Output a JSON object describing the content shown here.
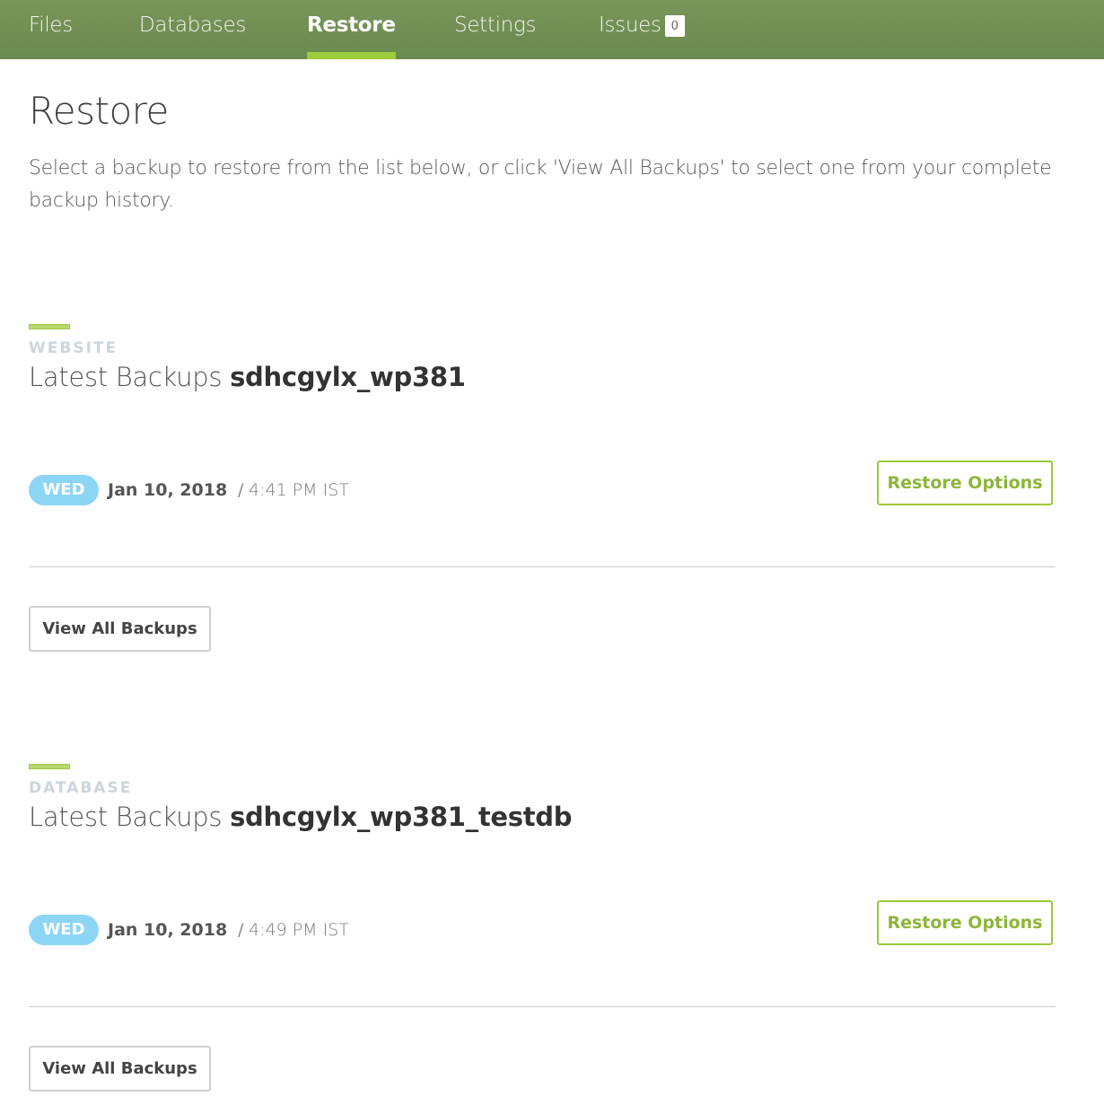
{
  "nav": {
    "tabs": [
      {
        "label": "Files"
      },
      {
        "label": "Databases"
      },
      {
        "label": "Restore",
        "active": true
      },
      {
        "label": "Settings"
      },
      {
        "label": "Issues",
        "count": "0"
      }
    ]
  },
  "page": {
    "title": "Restore",
    "intro": "Select a backup to restore from the list below, or click 'View All Backups' to select one from your complete backup history."
  },
  "sections": [
    {
      "kind": "WEBSITE",
      "heading_label": "Latest Backups",
      "heading_name": "sdhcgylx_wp381",
      "backup": {
        "day": "WED",
        "date": "Jan 10, 2018",
        "separator": "/",
        "time": "4:41 PM IST"
      },
      "restore_label": "Restore Options",
      "view_all_label": "View All Backups"
    },
    {
      "kind": "DATABASE",
      "heading_label": "Latest Backups",
      "heading_name": "sdhcgylx_wp381_testdb",
      "backup": {
        "day": "WED",
        "date": "Jan 10, 2018",
        "separator": "/",
        "time": "4:49 PM IST"
      },
      "restore_label": "Restore Options",
      "view_all_label": "View All Backups"
    }
  ],
  "colors": {
    "nav_bg": "#72904f",
    "active_underline": "#9ccb3c",
    "day_badge": "#8cd5f5",
    "restore_accent": "#9cc93a"
  }
}
